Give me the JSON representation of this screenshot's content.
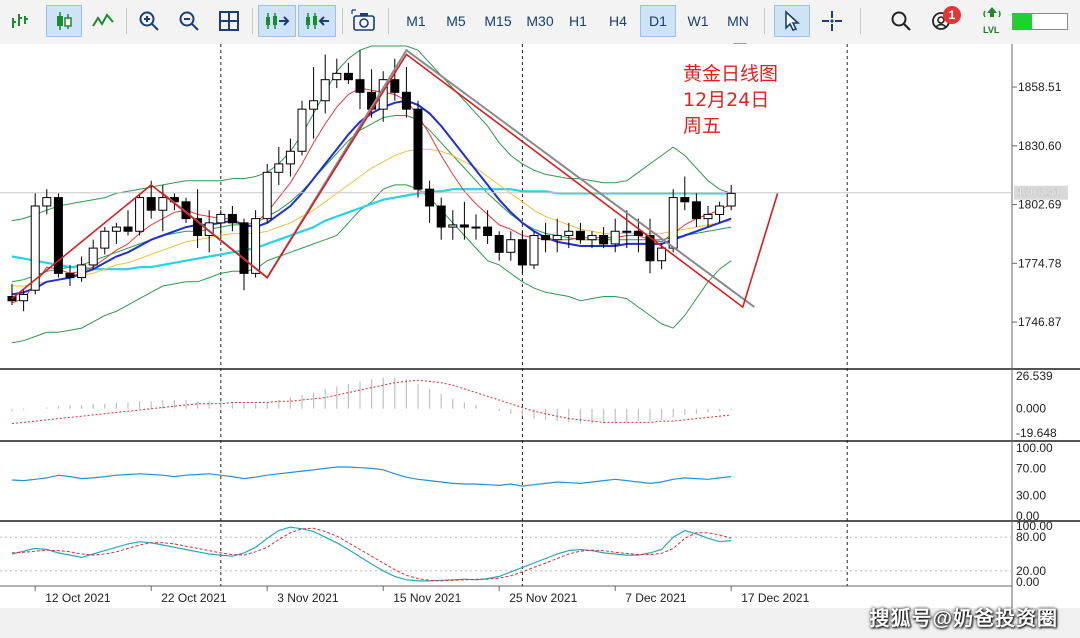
{
  "toolbar": {
    "timeframes": [
      "M1",
      "M5",
      "M15",
      "M30",
      "H1",
      "H4",
      "D1",
      "W1",
      "MN"
    ],
    "active_timeframe": "D1",
    "notification_count": "1",
    "lvl_label": "LVL",
    "signal_level": 0.35,
    "icons": [
      "line-chart-icon",
      "candlestick-icon",
      "line-wave-icon",
      "zoom-in-icon",
      "zoom-out-icon",
      "grid-icon",
      "autoscroll-icon",
      "chart-shift-icon",
      "screenshot-icon",
      "cursor-icon",
      "crosshair-icon",
      "search-icon",
      "notifications-icon",
      "signal-icon"
    ]
  },
  "annotation": [
    "黄金日线图",
    "12月24日",
    "周五"
  ],
  "watermark": "搜狐号@奶爸投资圈",
  "chart_data": [
    {
      "type": "candlestick",
      "title": "",
      "price_axis": [
        "1858.51",
        "1830.60",
        "1802.69",
        "1774.78",
        "1746.87"
      ],
      "price_ticks": [
        1858.51,
        1830.6,
        1802.69,
        1774.78,
        1746.87
      ],
      "price_highlight": "1808.31",
      "price_highlight_value": 1808.31,
      "ylim": [
        1726,
        1878
      ],
      "x_labels": [
        "12 Oct 2021",
        "22 Oct 2021",
        "3 Nov 2021",
        "15 Nov 2021",
        "25 Nov 2021",
        "7 Dec 2021",
        "17 Dec 2021"
      ],
      "x_label_index": [
        2,
        12,
        22,
        32,
        42,
        52,
        62
      ],
      "vline_index": [
        18,
        44,
        72
      ],
      "candles": [
        [
          1759,
          1765,
          1755,
          1757
        ],
        [
          1757,
          1762,
          1752,
          1760
        ],
        [
          1762,
          1808,
          1760,
          1802
        ],
        [
          1802,
          1810,
          1798,
          1806
        ],
        [
          1806,
          1808,
          1768,
          1770
        ],
        [
          1770,
          1774,
          1764,
          1768
        ],
        [
          1768,
          1778,
          1766,
          1774
        ],
        [
          1774,
          1786,
          1772,
          1782
        ],
        [
          1782,
          1792,
          1779,
          1790
        ],
        [
          1790,
          1794,
          1784,
          1792
        ],
        [
          1792,
          1800,
          1788,
          1790
        ],
        [
          1790,
          1808,
          1788,
          1806
        ],
        [
          1806,
          1814,
          1796,
          1800
        ],
        [
          1800,
          1812,
          1790,
          1806
        ],
        [
          1806,
          1808,
          1800,
          1804
        ],
        [
          1804,
          1806,
          1794,
          1796
        ],
        [
          1796,
          1810,
          1782,
          1788
        ],
        [
          1788,
          1800,
          1780,
          1794
        ],
        [
          1794,
          1800,
          1788,
          1798
        ],
        [
          1798,
          1802,
          1790,
          1794
        ],
        [
          1794,
          1796,
          1762,
          1770
        ],
        [
          1770,
          1800,
          1768,
          1796
        ],
        [
          1796,
          1822,
          1794,
          1818
        ],
        [
          1818,
          1830,
          1812,
          1822
        ],
        [
          1822,
          1834,
          1816,
          1828
        ],
        [
          1828,
          1852,
          1826,
          1848
        ],
        [
          1848,
          1868,
          1834,
          1852
        ],
        [
          1852,
          1874,
          1846,
          1862
        ],
        [
          1862,
          1872,
          1858,
          1865
        ],
        [
          1865,
          1870,
          1860,
          1862
        ],
        [
          1862,
          1876,
          1848,
          1856
        ],
        [
          1856,
          1867,
          1844,
          1848
        ],
        [
          1848,
          1866,
          1842,
          1862
        ],
        [
          1862,
          1872,
          1852,
          1856
        ],
        [
          1856,
          1868,
          1844,
          1848
        ],
        [
          1848,
          1852,
          1806,
          1810
        ],
        [
          1810,
          1814,
          1794,
          1802
        ],
        [
          1802,
          1806,
          1786,
          1792
        ],
        [
          1792,
          1800,
          1786,
          1793
        ],
        [
          1793,
          1804,
          1786,
          1792
        ],
        [
          1792,
          1798,
          1786,
          1792
        ],
        [
          1792,
          1800,
          1784,
          1788
        ],
        [
          1788,
          1790,
          1776,
          1780
        ],
        [
          1780,
          1790,
          1776,
          1786
        ],
        [
          1786,
          1790,
          1770,
          1774
        ],
        [
          1774,
          1790,
          1772,
          1788
        ],
        [
          1788,
          1794,
          1780,
          1786
        ],
        [
          1786,
          1796,
          1780,
          1788
        ],
        [
          1788,
          1794,
          1782,
          1790
        ],
        [
          1790,
          1794,
          1784,
          1786
        ],
        [
          1786,
          1790,
          1782,
          1788
        ],
        [
          1788,
          1792,
          1782,
          1784
        ],
        [
          1784,
          1796,
          1780,
          1790
        ],
        [
          1790,
          1800,
          1782,
          1790
        ],
        [
          1790,
          1796,
          1780,
          1788
        ],
        [
          1788,
          1796,
          1770,
          1776
        ],
        [
          1776,
          1784,
          1772,
          1782
        ],
        [
          1782,
          1810,
          1780,
          1806
        ],
        [
          1806,
          1816,
          1800,
          1804
        ],
        [
          1804,
          1808,
          1792,
          1796
        ],
        [
          1796,
          1802,
          1792,
          1798
        ],
        [
          1798,
          1804,
          1794,
          1802
        ],
        [
          1802,
          1812,
          1800,
          1808
        ]
      ],
      "ma_fast": [
        1756,
        1758,
        1765,
        1773,
        1772,
        1770,
        1771,
        1773,
        1777,
        1781,
        1784,
        1789,
        1793,
        1796,
        1799,
        1800,
        1798,
        1797,
        1796,
        1796,
        1793,
        1794,
        1799,
        1806,
        1813,
        1822,
        1832,
        1841,
        1849,
        1855,
        1858,
        1857,
        1856,
        1855,
        1852,
        1845,
        1836,
        1826,
        1817,
        1809,
        1803,
        1798,
        1793,
        1791,
        1788,
        1787,
        1786,
        1786,
        1786,
        1787,
        1787,
        1787,
        1787,
        1788,
        1788,
        1786,
        1785,
        1789,
        1793,
        1796,
        1798,
        1800,
        1803
      ],
      "ma_mid": [
        1760,
        1761,
        1763,
        1766,
        1767,
        1768,
        1770,
        1772,
        1775,
        1778,
        1780,
        1783,
        1786,
        1788,
        1790,
        1792,
        1793,
        1793,
        1794,
        1795,
        1793,
        1792,
        1794,
        1798,
        1802,
        1808,
        1815,
        1822,
        1829,
        1836,
        1842,
        1846,
        1849,
        1851,
        1852,
        1850,
        1846,
        1840,
        1833,
        1826,
        1819,
        1812,
        1805,
        1799,
        1794,
        1790,
        1787,
        1785,
        1784,
        1783,
        1783,
        1783,
        1783,
        1784,
        1784,
        1784,
        1784,
        1786,
        1788,
        1790,
        1792,
        1794,
        1796
      ],
      "ma_slow": [
        1764,
        1764,
        1765,
        1766,
        1767,
        1768,
        1769,
        1770,
        1772,
        1774,
        1775,
        1777,
        1779,
        1781,
        1783,
        1785,
        1786,
        1787,
        1788,
        1789,
        1789,
        1789,
        1790,
        1792,
        1794,
        1797,
        1800,
        1804,
        1808,
        1812,
        1816,
        1820,
        1823,
        1826,
        1828,
        1829,
        1829,
        1828,
        1826,
        1823,
        1820,
        1816,
        1812,
        1808,
        1804,
        1800,
        1797,
        1795,
        1793,
        1791,
        1790,
        1789,
        1789,
        1789,
        1789,
        1789,
        1789,
        1790,
        1791,
        1792,
        1793,
        1794,
        1795
      ],
      "ma_long": [
        1778,
        1777,
        1776,
        1775,
        1774,
        1773,
        1773,
        1772,
        1772,
        1772,
        1772,
        1773,
        1773,
        1774,
        1775,
        1776,
        1777,
        1778,
        1779,
        1780,
        1781,
        1782,
        1784,
        1786,
        1788,
        1790,
        1792,
        1795,
        1797,
        1799,
        1801,
        1803,
        1805,
        1806,
        1807,
        1808,
        1809,
        1809,
        1810,
        1810,
        1810,
        1810,
        1810,
        1810,
        1809,
        1809,
        1809,
        1808,
        1808,
        1808,
        1808,
        1808,
        1808,
        1808,
        1808,
        1808,
        1808,
        1808,
        1808,
        1808,
        1808,
        1808,
        1808
      ],
      "boll_upper": [
        1795,
        1796,
        1798,
        1800,
        1802,
        1803,
        1804,
        1805,
        1806,
        1808,
        1809,
        1810,
        1811,
        1812,
        1813,
        1814,
        1814,
        1814,
        1814,
        1815,
        1815,
        1816,
        1818,
        1822,
        1828,
        1836,
        1846,
        1856,
        1866,
        1872,
        1876,
        1878,
        1878,
        1878,
        1878,
        1876,
        1870,
        1864,
        1858,
        1852,
        1846,
        1840,
        1832,
        1826,
        1822,
        1819,
        1817,
        1816,
        1815,
        1815,
        1814,
        1813,
        1813,
        1814,
        1818,
        1822,
        1826,
        1830,
        1826,
        1820,
        1814,
        1810,
        1808
      ],
      "boll_mid": [
        1766,
        1767,
        1769,
        1771,
        1772,
        1773,
        1774,
        1776,
        1778,
        1780,
        1782,
        1784,
        1786,
        1788,
        1789,
        1790,
        1790,
        1791,
        1792,
        1793,
        1793,
        1794,
        1797,
        1800,
        1804,
        1809,
        1815,
        1821,
        1827,
        1833,
        1838,
        1841,
        1844,
        1845,
        1845,
        1843,
        1838,
        1832,
        1826,
        1820,
        1814,
        1808,
        1803,
        1798,
        1794,
        1791,
        1789,
        1788,
        1787,
        1786,
        1786,
        1786,
        1786,
        1786,
        1786,
        1786,
        1786,
        1787,
        1788,
        1789,
        1790,
        1791,
        1792
      ],
      "boll_lower": [
        1737,
        1738,
        1740,
        1742,
        1742,
        1743,
        1744,
        1747,
        1750,
        1752,
        1755,
        1758,
        1761,
        1764,
        1765,
        1766,
        1766,
        1768,
        1770,
        1771,
        1771,
        1772,
        1776,
        1778,
        1780,
        1782,
        1784,
        1786,
        1788,
        1794,
        1800,
        1804,
        1810,
        1812,
        1812,
        1810,
        1806,
        1800,
        1794,
        1788,
        1782,
        1776,
        1774,
        1770,
        1766,
        1763,
        1761,
        1760,
        1759,
        1757,
        1758,
        1759,
        1759,
        1758,
        1754,
        1750,
        1746,
        1744,
        1750,
        1758,
        1766,
        1772,
        1776
      ],
      "zigzag": [
        [
          0,
          1758
        ],
        [
          12,
          1812
        ],
        [
          22,
          1768
        ],
        [
          34,
          1874
        ],
        [
          63,
          1754
        ],
        [
          66,
          1808
        ]
      ],
      "grey_line": [
        [
          13,
          1808
        ],
        [
          22,
          1768
        ],
        [
          34,
          1876
        ],
        [
          64,
          1754
        ]
      ]
    },
    {
      "type": "histogram",
      "axis_labels": [
        "26.539",
        "0.000",
        "-19.648"
      ],
      "axis_values": [
        26.539,
        0,
        -19.648
      ],
      "ylim": [
        -22,
        28
      ],
      "values": [
        -2,
        -1,
        0,
        1,
        2,
        3,
        3,
        4,
        4,
        5,
        5,
        6,
        6,
        7,
        7,
        7,
        6,
        6,
        6,
        5,
        4,
        4,
        5,
        7,
        9,
        11,
        13,
        16,
        18,
        20,
        22,
        24,
        25,
        25,
        24,
        20,
        16,
        12,
        8,
        5,
        3,
        0,
        -2,
        -4,
        -6,
        -8,
        -9,
        -10,
        -11,
        -12,
        -12,
        -12,
        -12,
        -11,
        -10,
        -10,
        -9,
        -7,
        -5,
        -4,
        -3,
        -2,
        -1
      ],
      "signal": [
        -12,
        -11,
        -10,
        -9,
        -8,
        -7,
        -6,
        -5,
        -4,
        -3,
        -2,
        -1,
        0,
        1,
        2,
        3,
        4,
        4,
        4,
        5,
        5,
        5,
        5,
        6,
        6,
        7,
        8,
        9,
        11,
        13,
        15,
        17,
        19,
        21,
        22,
        23,
        22,
        21,
        19,
        16,
        13,
        10,
        7,
        4,
        1,
        -2,
        -4,
        -6,
        -8,
        -9,
        -10,
        -11,
        -11,
        -11,
        -11,
        -11,
        -10,
        -10,
        -9,
        -8,
        -7,
        -6,
        -5
      ]
    },
    {
      "type": "line",
      "axis_labels": [
        "100.00",
        "70.00",
        "30.00",
        "0.00"
      ],
      "axis_values": [
        100,
        70,
        30,
        0
      ],
      "ylim": [
        0,
        100
      ],
      "values": [
        53,
        52,
        54,
        56,
        60,
        58,
        55,
        56,
        58,
        60,
        61,
        62,
        61,
        60,
        58,
        60,
        61,
        62,
        60,
        58,
        55,
        57,
        60,
        62,
        64,
        66,
        68,
        70,
        72,
        72,
        71,
        70,
        68,
        62,
        57,
        54,
        52,
        50,
        48,
        47,
        47,
        46,
        45,
        47,
        44,
        46,
        48,
        50,
        49,
        48,
        50,
        52,
        54,
        52,
        50,
        48,
        50,
        54,
        56,
        55,
        54,
        56,
        58
      ]
    },
    {
      "type": "line",
      "axis_labels": [
        "100.00",
        "80.00",
        "20.00",
        "0.00"
      ],
      "axis_values": [
        100,
        80,
        20,
        0
      ],
      "ylim": [
        0,
        100
      ],
      "k": [
        50,
        55,
        60,
        58,
        52,
        48,
        44,
        50,
        56,
        62,
        68,
        72,
        70,
        66,
        62,
        58,
        54,
        50,
        48,
        46,
        52,
        62,
        78,
        92,
        98,
        95,
        90,
        80,
        70,
        58,
        45,
        32,
        20,
        10,
        4,
        2,
        2,
        3,
        4,
        5,
        4,
        6,
        10,
        18,
        26,
        34,
        42,
        50,
        56,
        58,
        56,
        52,
        50,
        48,
        48,
        52,
        58,
        80,
        92,
        86,
        78,
        72,
        74
      ],
      "d": [
        52,
        53,
        55,
        57,
        56,
        54,
        50,
        48,
        50,
        54,
        60,
        66,
        70,
        70,
        68,
        64,
        60,
        56,
        52,
        49,
        48,
        54,
        62,
        76,
        88,
        95,
        96,
        90,
        82,
        70,
        58,
        46,
        34,
        22,
        12,
        6,
        3,
        2,
        3,
        4,
        5,
        5,
        7,
        11,
        18,
        26,
        34,
        42,
        50,
        55,
        57,
        56,
        53,
        51,
        49,
        49,
        51,
        60,
        78,
        88,
        88,
        84,
        78
      ]
    }
  ]
}
